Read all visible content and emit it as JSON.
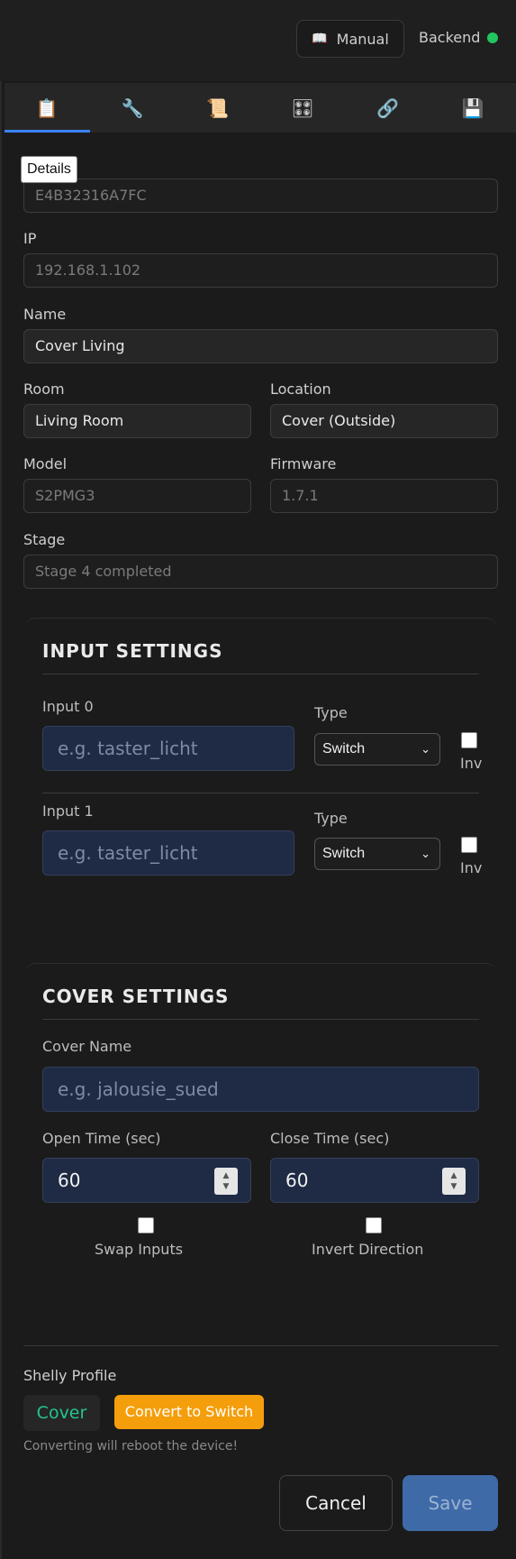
{
  "header": {
    "manual_icon": "book-icon",
    "manual_label": "Manual",
    "backend_label": "Backend",
    "backend_status_color": "#22c55e"
  },
  "tabs": [
    {
      "icon": "clipboard-icon",
      "glyph": "📋",
      "active": true
    },
    {
      "icon": "wrench-icon",
      "glyph": "🔧",
      "active": false
    },
    {
      "icon": "scroll-icon",
      "glyph": "📜",
      "active": false
    },
    {
      "icon": "remote-icon",
      "glyph": "🎛",
      "active": false
    },
    {
      "icon": "link-icon",
      "glyph": "🔗",
      "active": false
    },
    {
      "icon": "floppy-disk-icon",
      "glyph": "💾",
      "active": false
    }
  ],
  "tooltip": "Details",
  "details": {
    "id_value": "E4B32316A7FC",
    "ip_label": "IP",
    "ip_value": "192.168.1.102",
    "name_label": "Name",
    "name_value": "Cover Living",
    "room_label": "Room",
    "room_value": "Living Room",
    "location_label": "Location",
    "location_value": "Cover (Outside)",
    "model_label": "Model",
    "model_value": "S2PMG3",
    "firmware_label": "Firmware",
    "firmware_value": "1.7.1",
    "stage_label": "Stage",
    "stage_value": "Stage 4 completed"
  },
  "input_settings": {
    "title": "INPUT SETTINGS",
    "inputs": [
      {
        "label": "Input 0",
        "placeholder": "e.g. taster_licht",
        "type_label": "Type",
        "type_value": "Switch",
        "inv_label": "Inv"
      },
      {
        "label": "Input 1",
        "placeholder": "e.g. taster_licht",
        "type_label": "Type",
        "type_value": "Switch",
        "inv_label": "Inv"
      }
    ]
  },
  "cover_settings": {
    "title": "COVER SETTINGS",
    "name_label": "Cover Name",
    "name_placeholder": "e.g. jalousie_sued",
    "open_label": "Open Time (sec)",
    "open_value": "60",
    "close_label": "Close Time (sec)",
    "close_value": "60",
    "swap_label": "Swap Inputs",
    "invert_label": "Invert Direction"
  },
  "profile": {
    "label": "Shelly Profile",
    "value": "Cover",
    "convert_label": "Convert to Switch",
    "warning": "Converting will reboot the device!"
  },
  "actions": {
    "cancel_label": "Cancel",
    "save_label": "Save"
  }
}
